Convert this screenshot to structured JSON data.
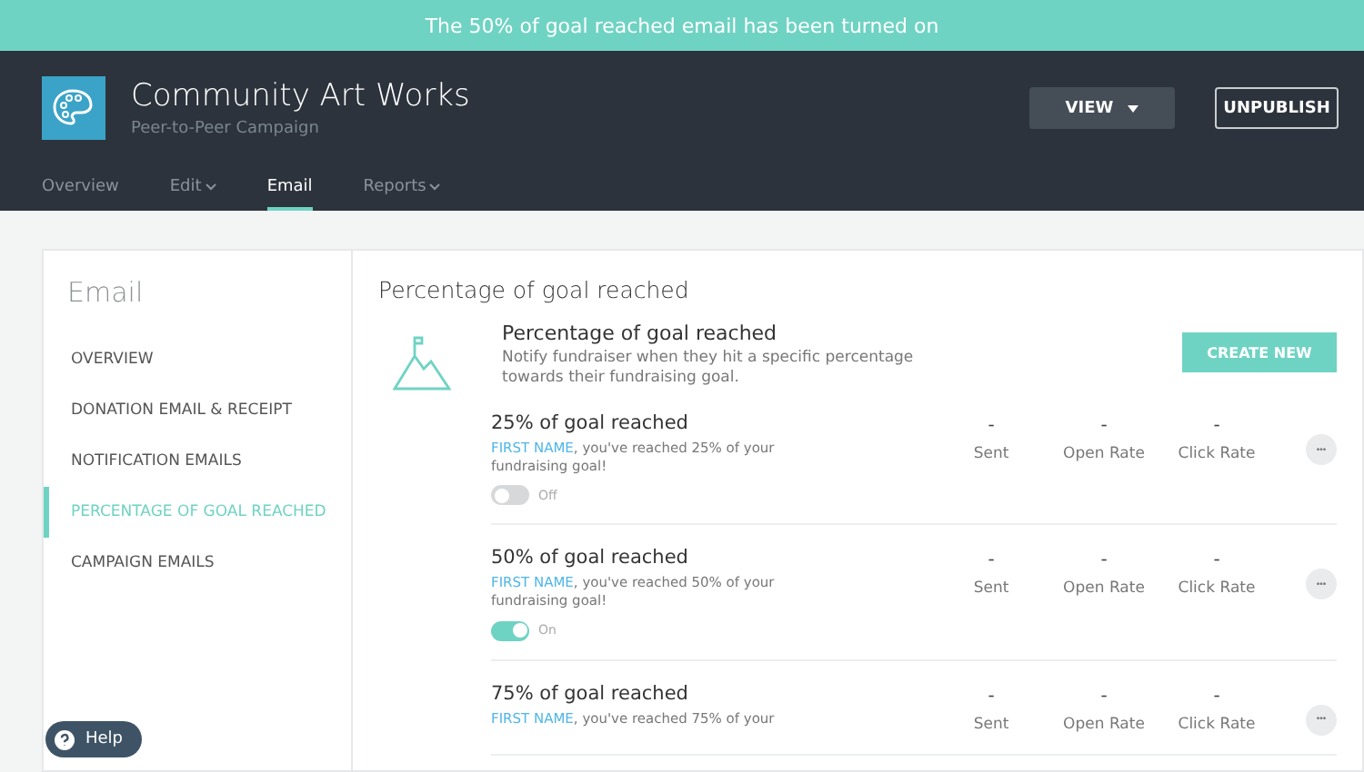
{
  "notification": {
    "text": "The 50% of goal reached email has been turned on"
  },
  "campaign": {
    "title": "Community Art Works",
    "subtitle": "Peer-to-Peer Campaign"
  },
  "header_buttons": [
    {
      "label": "VIEW",
      "kind": "dropdown"
    },
    {
      "label": "UNPUBLISH",
      "kind": "outline"
    }
  ],
  "tabs": [
    {
      "label": "Overview",
      "selected": false,
      "dropdown": false
    },
    {
      "label": "Edit",
      "selected": false,
      "dropdown": true
    },
    {
      "label": "Email",
      "selected": true,
      "dropdown": false
    },
    {
      "label": "Reports",
      "selected": false,
      "dropdown": true
    }
  ],
  "sidebar": {
    "title": "Email",
    "items": [
      {
        "label": "OVERVIEW",
        "selected": false
      },
      {
        "label": "DONATION EMAIL & RECEIPT",
        "selected": false
      },
      {
        "label": "NOTIFICATION EMAILS",
        "selected": false
      },
      {
        "label": "PERCENTAGE OF GOAL REACHED",
        "selected": true
      },
      {
        "label": "CAMPAIGN EMAILS",
        "selected": false
      }
    ]
  },
  "section": {
    "heading": "Percentage of goal reached",
    "intro_title": "Percentage of goal reached",
    "intro_text": "Notify fundraiser when they hit a specific percentage towards their fundraising goal.",
    "create_button": "CREATE NEW"
  },
  "emails": [
    {
      "title": "25% of goal reached",
      "token": "FIRST NAME",
      "message": ", you've reached 25% of your fundraising goal!",
      "on": false,
      "state_label": "Off",
      "stats": [
        {
          "value": "-",
          "label": "Sent"
        },
        {
          "value": "-",
          "label": "Open Rate"
        },
        {
          "value": "-",
          "label": "Click Rate"
        }
      ],
      "more": "•••"
    },
    {
      "title": "50% of goal reached",
      "token": "FIRST NAME",
      "message": ", you've reached 50% of your fundraising goal!",
      "on": true,
      "state_label": "On",
      "stats": [
        {
          "value": "-",
          "label": "Sent"
        },
        {
          "value": "-",
          "label": "Open Rate"
        },
        {
          "value": "-",
          "label": "Click Rate"
        }
      ],
      "more": "•••"
    },
    {
      "title": "75% of goal reached",
      "token": "FIRST NAME",
      "message": ", you've reached 75% of your",
      "stats": [
        {
          "value": "-",
          "label": "Sent"
        },
        {
          "value": "-",
          "label": "Open Rate"
        },
        {
          "value": "-",
          "label": "Click Rate"
        }
      ],
      "more": "•••"
    }
  ],
  "help": {
    "label": "Help"
  }
}
